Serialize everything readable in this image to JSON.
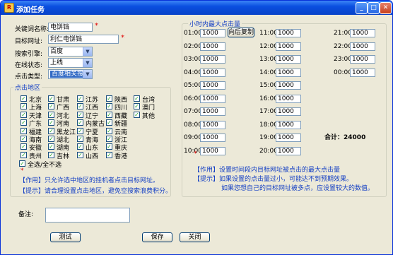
{
  "window": {
    "title": "添加任务",
    "icon_text": "R"
  },
  "form": {
    "keyword_label": "关键词名称:",
    "keyword_value": "电饼铛",
    "target_label": "目标网址:",
    "target_value": "利仁电饼铛",
    "engine_label": "搜索引擎:",
    "engine_value": "百度",
    "online_label": "在线状态:",
    "online_value": "上线",
    "click_type_label": "点击类型:",
    "click_type_value": "百度相关搜索"
  },
  "region": {
    "title": "点击地区",
    "columns": [
      [
        "北京",
        "上海",
        "天津",
        "广东",
        "福建",
        "海南",
        "安徽",
        "贵州"
      ],
      [
        "甘肃",
        "广西",
        "河北",
        "河南",
        "黑龙江",
        "湖北",
        "湖南",
        "吉林"
      ],
      [
        "江苏",
        "江西",
        "辽宁",
        "内蒙古",
        "宁夏",
        "青海",
        "山东",
        "山西"
      ],
      [
        "陕西",
        "四川",
        "西藏",
        "新疆",
        "云南",
        "浙江",
        "重庆",
        "香港"
      ],
      [
        "台湾",
        "澳门",
        "其他"
      ]
    ],
    "select_all_label": "全选/全不选",
    "effect_tag": "【作用】",
    "effect_text": "只允许选中地区的挂机者点击目标网址。",
    "hint_tag": "【提示】",
    "hint_text": "请合理设置点击地区，避免空搜索浪费积分。"
  },
  "hourly": {
    "title": "小时内最大点击量",
    "copy_button": "向后复制",
    "hours": [
      {
        "label": "01:00",
        "value": "1000"
      },
      {
        "label": "02:00",
        "value": "1000"
      },
      {
        "label": "03:00",
        "value": "1000"
      },
      {
        "label": "04:00",
        "value": "1000"
      },
      {
        "label": "05:00",
        "value": "1000"
      },
      {
        "label": "06:00",
        "value": "1000"
      },
      {
        "label": "07:00",
        "value": "1000"
      },
      {
        "label": "08:00",
        "value": "1000"
      },
      {
        "label": "09:00",
        "value": "1000"
      },
      {
        "label": "10:00",
        "value": "1000"
      },
      {
        "label": "11:00",
        "value": "1000"
      },
      {
        "label": "12:00",
        "value": "1000"
      },
      {
        "label": "13:00",
        "value": "1000"
      },
      {
        "label": "14:00",
        "value": "1000"
      },
      {
        "label": "15:00",
        "value": "1000"
      },
      {
        "label": "16:00",
        "value": "1000"
      },
      {
        "label": "17:00",
        "value": "1000"
      },
      {
        "label": "18:00",
        "value": "1000"
      },
      {
        "label": "19:00",
        "value": "1000"
      },
      {
        "label": "20:00",
        "value": "1000"
      },
      {
        "label": "21:00",
        "value": "1000"
      },
      {
        "label": "22:00",
        "value": "1000"
      },
      {
        "label": "23:00",
        "value": "1000"
      },
      {
        "label": "00:00",
        "value": "1000"
      }
    ],
    "total_label": "合计：",
    "total_value": "24000",
    "effect_tag": "【作用】",
    "effect_text": "设置时间段内目标网址被点击的最大点击量",
    "hint_tag": "【提示】",
    "hint_text1": "如果设置的点击量过小，可能达不到预期效果。",
    "hint_text2": "如果您想自己的目标网址被多点，应设置较大的数值。"
  },
  "remark_label": "备注:",
  "buttons": {
    "test": "测试",
    "save": "保存",
    "close": "关闭"
  },
  "colors": {
    "accent": "#1540c4",
    "required": "#e00000"
  }
}
